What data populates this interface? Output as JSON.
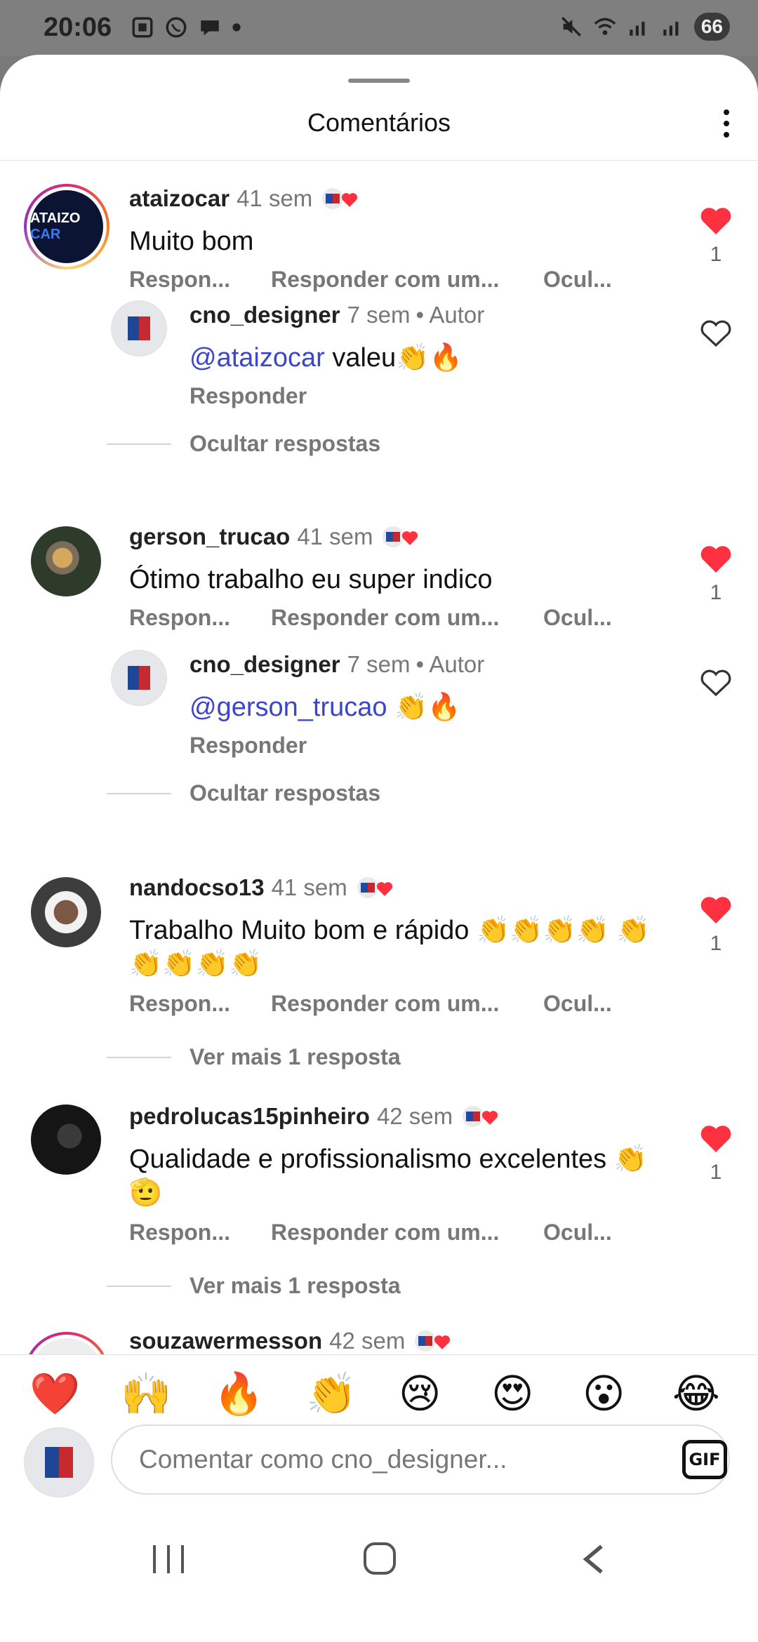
{
  "status": {
    "time": "20:06",
    "battery": "66"
  },
  "header": {
    "title": "Comentários"
  },
  "comments": [
    {
      "username": "ataizocar",
      "time": "41 sem",
      "text": "Muito bom",
      "actions": [
        "Respon...",
        "Responder com um...",
        "Ocul..."
      ],
      "like_count": "1",
      "avatar_text": "ATAIZO",
      "avatar_text2": "CAR"
    },
    {
      "username": "cno_designer",
      "time": "7 sem",
      "author": "• Autor",
      "mention": "@ataizocar",
      "text": " valeu👏🔥",
      "reply": "Responder",
      "toggle": "Ocultar respostas"
    },
    {
      "username": "gerson_trucao",
      "time": "41 sem",
      "text": "Ótimo trabalho eu super indico",
      "actions": [
        "Respon...",
        "Responder com um...",
        "Ocul..."
      ],
      "like_count": "1"
    },
    {
      "username": "cno_designer",
      "time": "7 sem",
      "author": "• Autor",
      "mention": "@gerson_trucao",
      "text": " 👏🔥",
      "reply": "Responder",
      "toggle": "Ocultar respostas"
    },
    {
      "username": "nandocso13",
      "time": "41 sem",
      "text": "Trabalho Muito bom e rápido 👏👏👏👏 👏👏👏👏👏",
      "actions": [
        "Respon...",
        "Responder com um...",
        "Ocul..."
      ],
      "like_count": "1",
      "toggle": "Ver mais 1 resposta"
    },
    {
      "username": "pedrolucas15pinheiro",
      "time": "42 sem",
      "text": "Qualidade e profissionalismo  excelentes 👏🫡",
      "actions": [
        "Respon...",
        "Responder com um...",
        "Ocul..."
      ],
      "like_count": "1",
      "toggle": "Ver mais 1 resposta"
    },
    {
      "username": "souzawermesson",
      "time": "42 sem"
    }
  ],
  "emoji_bar": [
    "❤️",
    "🙌",
    "🔥",
    "👏",
    "😢",
    "😍",
    "😮",
    "😂"
  ],
  "composer": {
    "placeholder": "Comentar como cno_designer...",
    "gif_label": "GIF"
  },
  "colors": {
    "like_red": "#ff3040",
    "mention_blue": "#3b47c7"
  },
  "icons": {
    "like_filled": "heart-filled-icon",
    "like_outline": "heart-outline-icon",
    "more": "more-vertical-icon"
  }
}
